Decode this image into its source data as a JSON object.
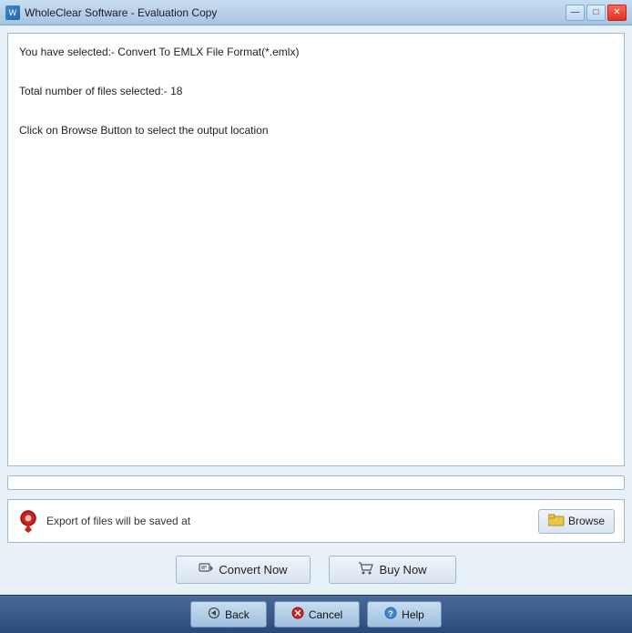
{
  "window": {
    "title": "WholeClear Software - Evaluation Copy"
  },
  "title_controls": {
    "minimize": "—",
    "maximize": "□",
    "close": "✕"
  },
  "info_lines": [
    "You have selected:- Convert To EMLX File Format(*.emlx)",
    "Total number of files selected:- 18",
    "Click on Browse Button to select the output location"
  ],
  "output_section": {
    "label": "Export of files will be saved at",
    "browse_label": "Browse"
  },
  "action_buttons": {
    "convert_label": "Convert Now",
    "buy_label": "Buy Now"
  },
  "bottom_bar": {
    "back_label": "Back",
    "cancel_label": "Cancel",
    "help_label": "Help"
  },
  "icons": {
    "pin": "📍",
    "back_arrow": "◀",
    "cancel_x": "✕",
    "help_q": "?"
  }
}
